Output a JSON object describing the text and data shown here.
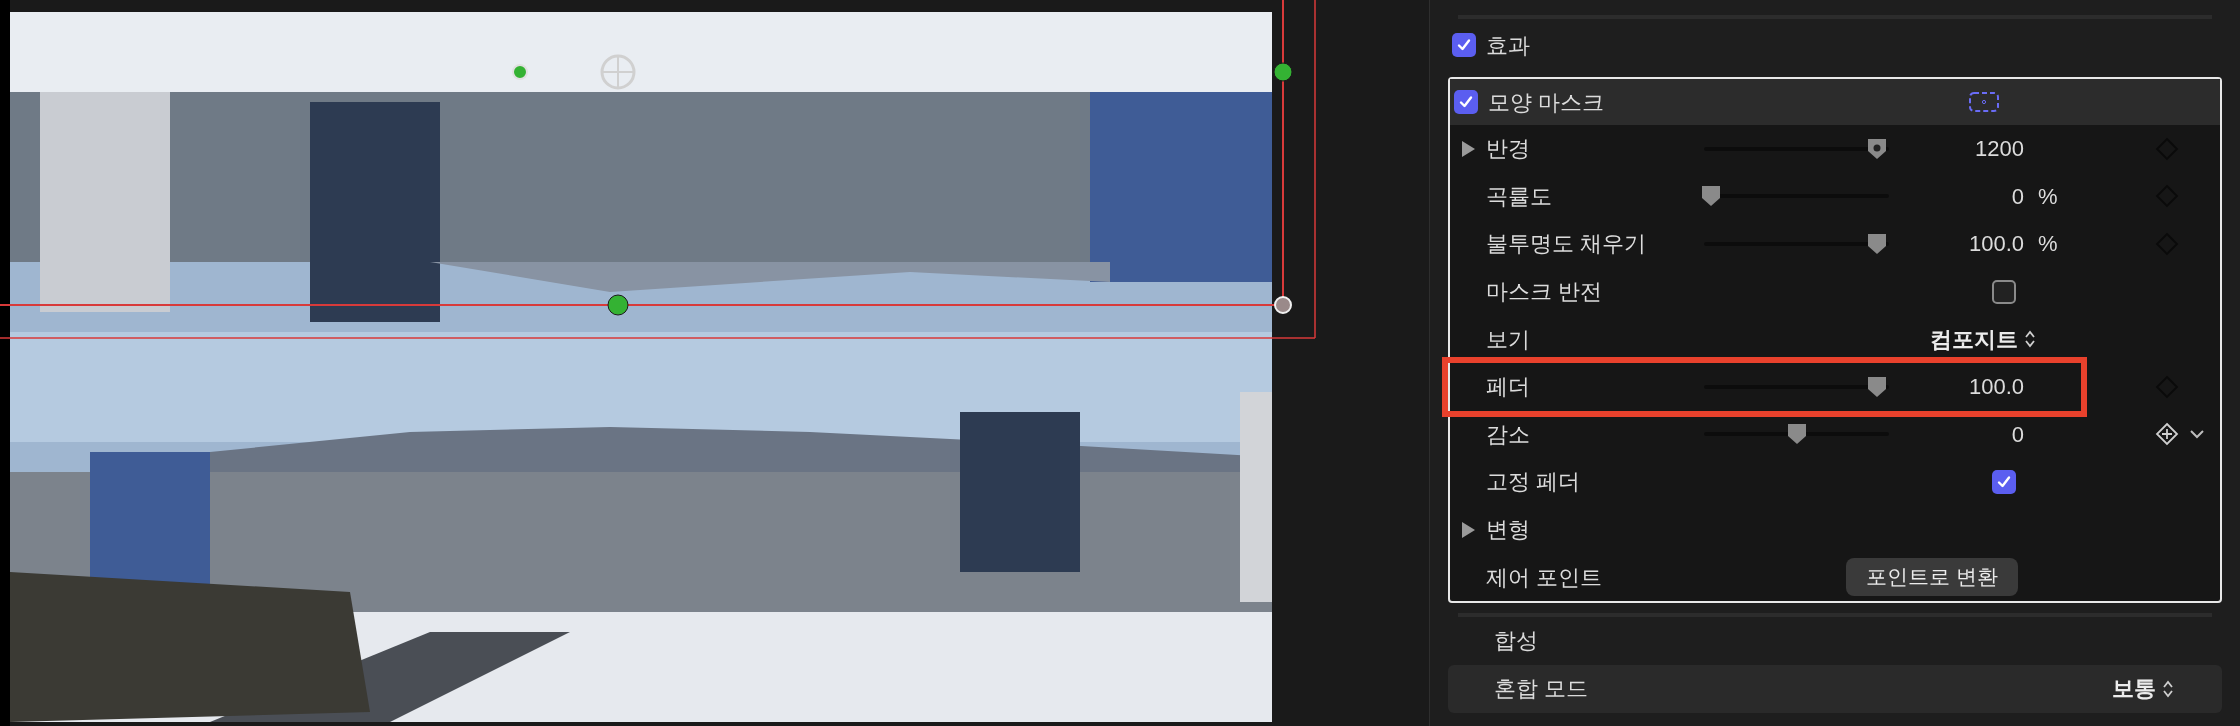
{
  "effects": {
    "label": "효과",
    "checked": true
  },
  "shape_mask": {
    "label": "모양 마스크",
    "checked": true,
    "rows": [
      {
        "kind": "slider",
        "label": "반경",
        "expanded": false,
        "level": 0.97,
        "value": "1200",
        "menu": false,
        "highlighted": false
      },
      {
        "kind": "slider",
        "label": "곡률도",
        "level": 0,
        "value": "0",
        "unit": "%",
        "menu": false,
        "highlighted": false
      },
      {
        "kind": "slider",
        "label": "불투명도 채우기",
        "level": 0.97,
        "value": "100.0",
        "unit": "%",
        "menu": false,
        "highlighted": false
      },
      {
        "kind": "checkbox",
        "label": "마스크 반전",
        "checked": false,
        "highlighted": false
      },
      {
        "kind": "popup",
        "label": "보기",
        "value": "컴포지트",
        "highlighted": false
      },
      {
        "kind": "slider",
        "label": "페더",
        "level": 0.97,
        "value": "100.0",
        "menu": false,
        "highlighted": true
      },
      {
        "kind": "slider",
        "label": "감소",
        "level": 0.5,
        "value": "0",
        "menu": true,
        "highlighted": false
      },
      {
        "kind": "checkbox",
        "label": "고정 페더",
        "checked": true,
        "highlighted": false
      },
      {
        "kind": "group",
        "label": "변형",
        "expanded": false,
        "highlighted": false
      },
      {
        "kind": "button",
        "label": "제어 포인트",
        "button": "포인트로 변환",
        "highlighted": false
      }
    ]
  },
  "compositing": {
    "label": "합성",
    "rows": [
      {
        "kind": "popup",
        "label": "혼합 모드",
        "value": "보통"
      }
    ]
  }
}
